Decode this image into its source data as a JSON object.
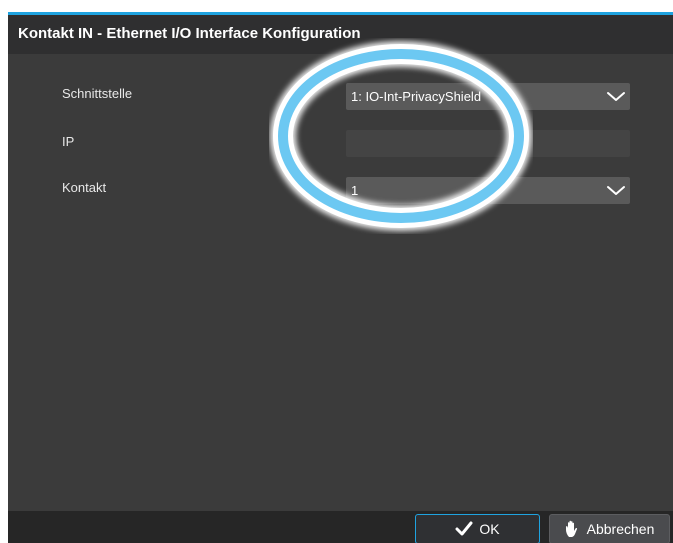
{
  "dialog": {
    "title": "Kontakt IN - Ethernet I/O Interface Konfiguration",
    "accent_color": "#1fa3e0",
    "background_color": "#3b3b3b"
  },
  "form": {
    "interface": {
      "label": "Schnittstelle",
      "value": "1: IO-Int-PrivacyShield"
    },
    "ip": {
      "label": "IP",
      "value": ""
    },
    "contact": {
      "label": "Kontakt",
      "value": "1"
    }
  },
  "footer": {
    "ok_label": "OK",
    "ok_icon": "checkmark-icon",
    "cancel_label": "Abbrechen",
    "cancel_icon": "hand-icon"
  },
  "annotation": {
    "ring_color": "#6cc8f2"
  }
}
